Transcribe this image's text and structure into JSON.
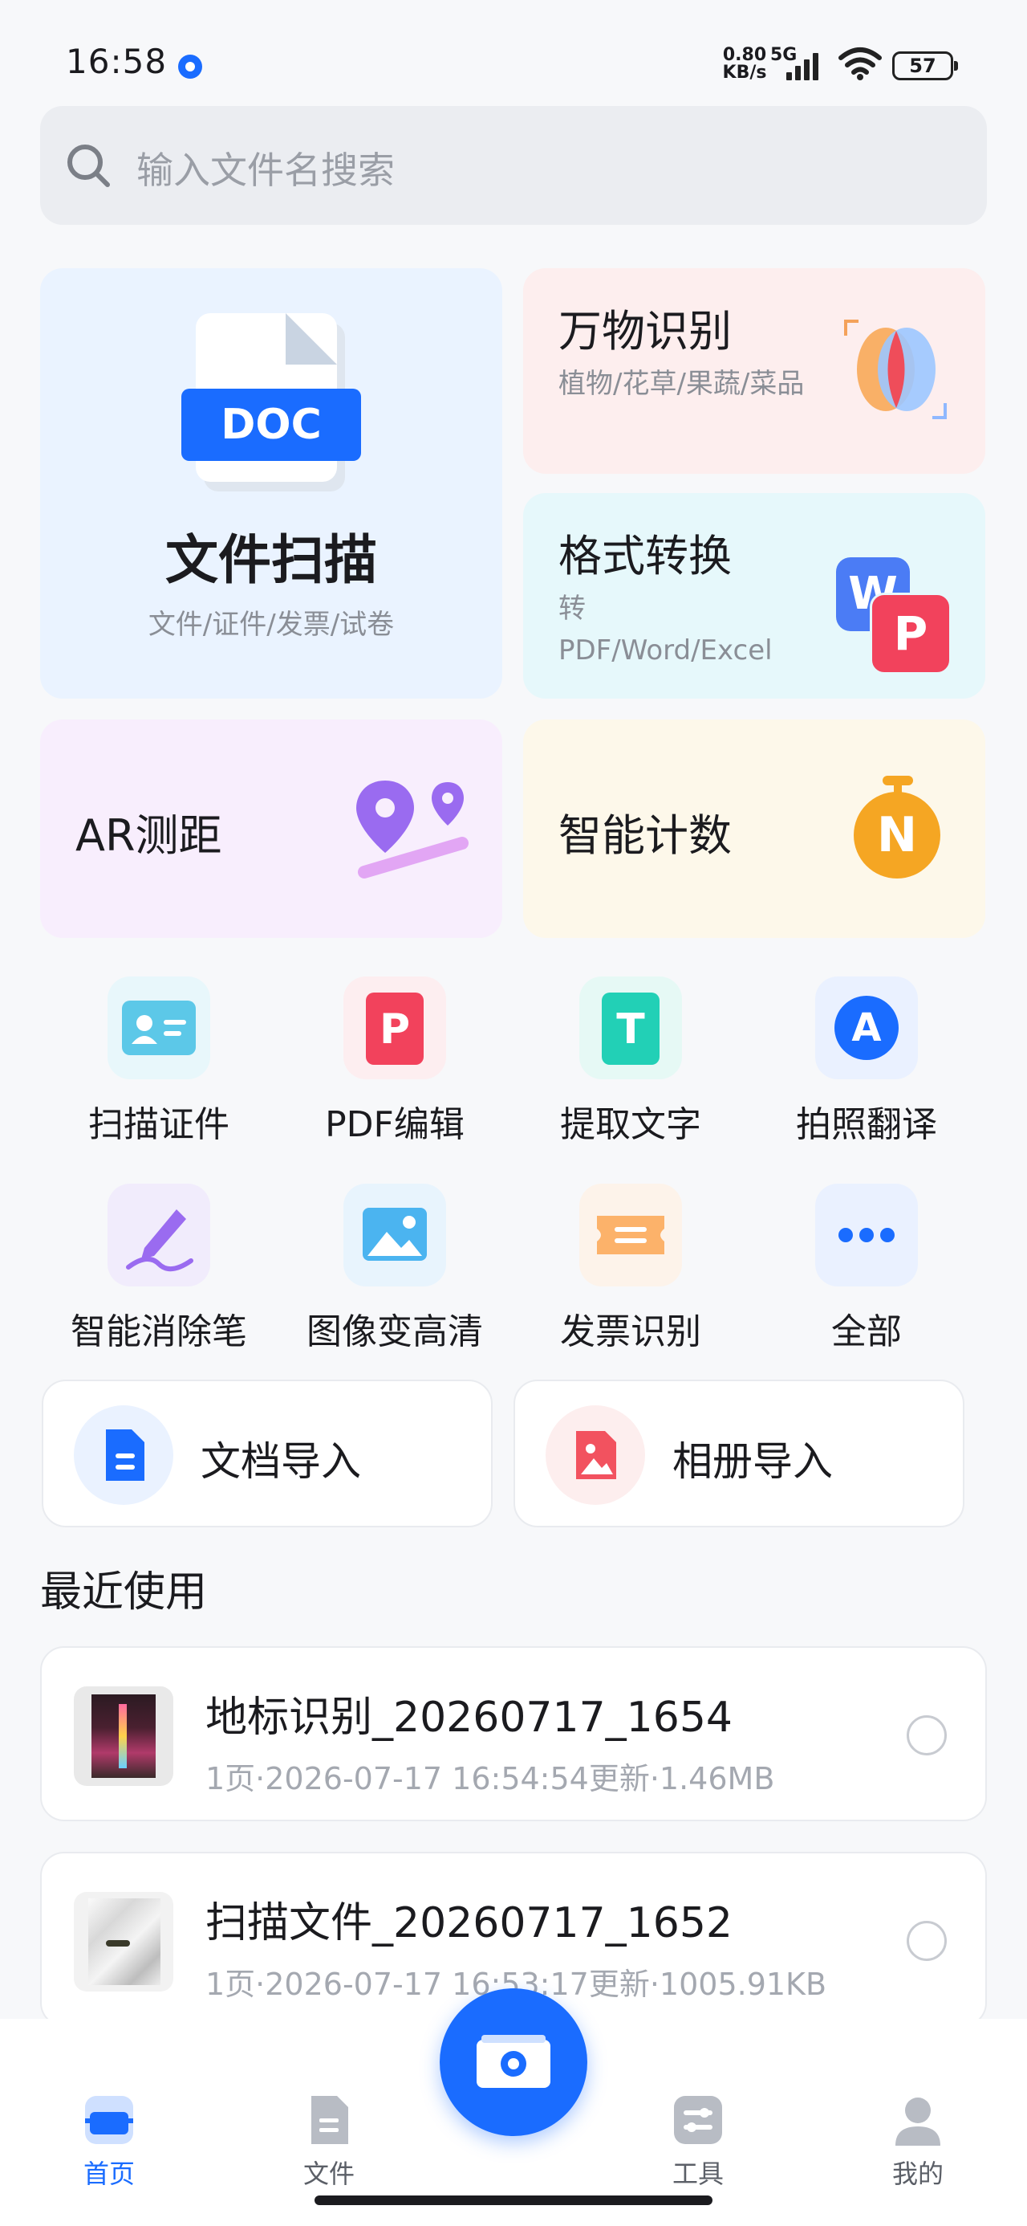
{
  "status_bar": {
    "time": "16:58",
    "net_speed_value": "0.80",
    "net_speed_unit": "KB/s",
    "network": "5G",
    "battery": "57"
  },
  "search": {
    "placeholder": "输入文件名搜索"
  },
  "feature_cards": {
    "doc_scan": {
      "badge": "DOC",
      "title": "文件扫描",
      "subtitle": "文件/证件/发票/试卷"
    },
    "object_recognition": {
      "title": "万物识别",
      "subtitle": "植物/花草/果蔬/菜品"
    },
    "format_convert": {
      "title": "格式转换",
      "subtitle": "转PDF/Word/Excel",
      "icon_letter_w": "W",
      "icon_letter_p": "P"
    },
    "ar_measure": {
      "title": "AR测距"
    },
    "smart_count": {
      "title": "智能计数",
      "icon_letter": "N"
    }
  },
  "tools": [
    {
      "label": "扫描证件",
      "icon": "id-card-icon"
    },
    {
      "label": "PDF编辑",
      "icon": "pdf-icon",
      "glyph": "P"
    },
    {
      "label": "提取文字",
      "icon": "text-extract-icon",
      "glyph": "T"
    },
    {
      "label": "拍照翻译",
      "icon": "translate-icon",
      "glyph": "A"
    },
    {
      "label": "智能消除笔",
      "icon": "eraser-pen-icon"
    },
    {
      "label": "图像变高清",
      "icon": "image-hd-icon"
    },
    {
      "label": "发票识别",
      "icon": "invoice-icon"
    },
    {
      "label": "全部",
      "icon": "more-icon"
    }
  ],
  "imports": {
    "document": {
      "label": "文档导入",
      "icon": "document-icon"
    },
    "album": {
      "label": "相册导入",
      "icon": "album-icon"
    }
  },
  "recent": {
    "heading": "最近使用",
    "files": [
      {
        "name": "地标识别_20260717_1654",
        "meta": "1页·2026-07-17 16:54:54更新·1.46MB"
      },
      {
        "name": "扫描文件_20260717_1652",
        "meta": "1页·2026-07-17 16:53:17更新·1005.91KB"
      }
    ]
  },
  "bottom_nav": {
    "home": "首页",
    "files": "文件",
    "tools": "工具",
    "mine": "我的"
  },
  "colors": {
    "accent": "#1a6cff",
    "doc_card_bg": "#eaf3ff",
    "recognition_card_bg": "#fdeeee",
    "convert_card_bg": "#e6f8fb",
    "ar_card_bg": "#f8eefd",
    "count_card_bg": "#fdf8ea"
  }
}
